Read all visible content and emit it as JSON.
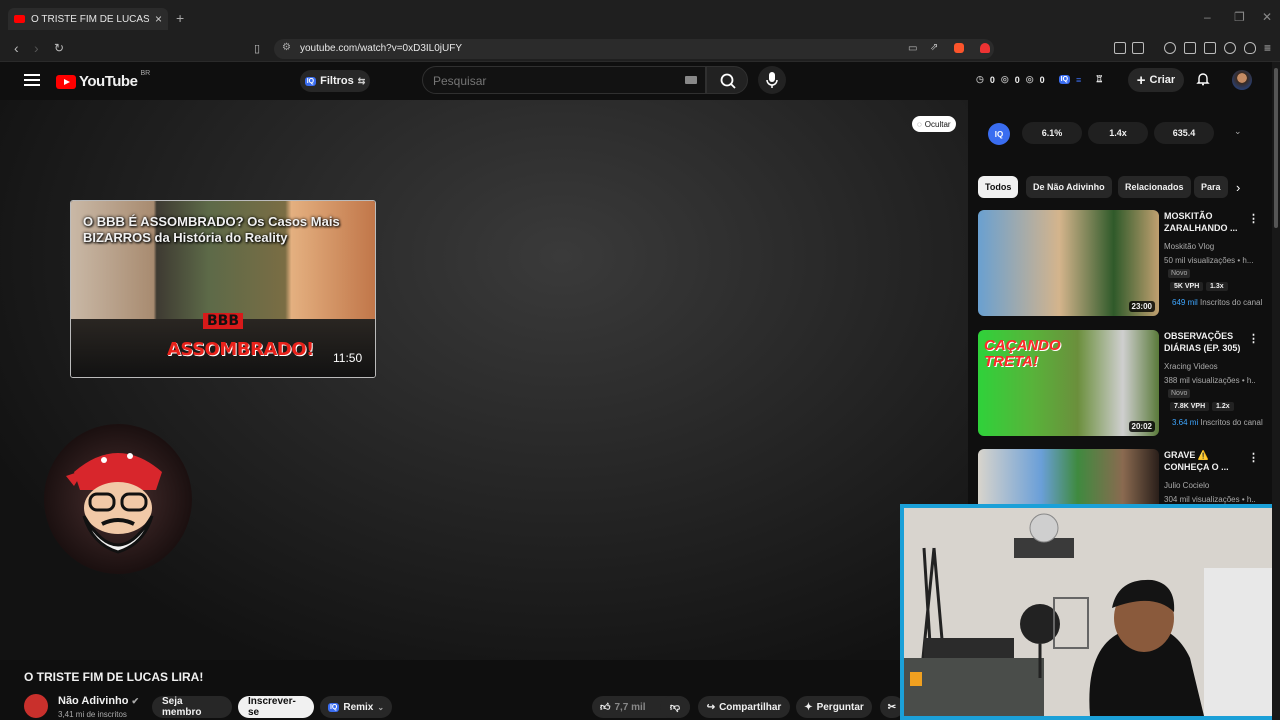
{
  "browser": {
    "tab_title": "O TRISTE FIM DE LUCAS LIRA! - YouTube",
    "url": "youtube.com/watch?v=0xD3IL0jUFY"
  },
  "header": {
    "logo": "YouTube",
    "country": "BR",
    "filters_label": "Filtros",
    "iq_label": "IQ",
    "search_placeholder": "Pesquisar",
    "counters": [
      "0",
      "0",
      "0"
    ],
    "create_label": "Criar"
  },
  "player": {
    "hide_label": "Ocultar",
    "endcard": {
      "title": "O BBB É ASSOMBRADO? Os Casos Mais BIZARROS da História do Reality",
      "bbb_text": "BBB",
      "assombrado_text": "ASSOMBRADO!",
      "duration": "11:50"
    }
  },
  "video": {
    "title": "O TRISTE FIM DE LUCAS LIRA!",
    "channel": "Não Adivinho",
    "subscribers": "3,41 mi de inscritos",
    "member_label": "Seja membro",
    "subscribe_label": "Inscrever-se",
    "remix_label": "Remix",
    "likes": "7,7 mil",
    "share_label": "Compartilhar",
    "ask_label": "Perguntar"
  },
  "sidebar": {
    "iq_metrics": [
      "6.1%",
      "1.4x",
      "635.4"
    ],
    "chips": [
      "Todos",
      "De Não Adivinho",
      "Relacionados",
      "Para"
    ],
    "recommendations": [
      {
        "title": "MOSKITÃO ZARALHANDO ...",
        "channel": "Moskitão Vlog",
        "views": "50 mil visualizações • h...",
        "badge": "Novo",
        "vph": "5K VPH",
        "ratio": "1.3x",
        "subs_count": "649 mil",
        "subs_label": "Inscritos do canal",
        "duration": "23:00",
        "colors": [
          "#6aa0d0",
          "#d4b48c",
          "#2f5a2a"
        ]
      },
      {
        "title": "OBSERVAÇÕES DIÁRIAS (EP. 305)",
        "channel": "Xracing Videos",
        "views": "388 mil visualizações • h...",
        "badge": "Novo",
        "vph": "7.8K VPH",
        "ratio": "1.2x",
        "subs_count": "3.64 mi",
        "subs_label": "Inscritos do canal",
        "duration": "20:02",
        "colors": [
          "#2fd23a",
          "#6b8f3c",
          "#cfcfcf"
        ]
      },
      {
        "title": "GRAVE ⚠️ CONHEÇA O ...",
        "channel": "Julio Cocielo",
        "views": "304 mil visualizações • h...",
        "duration": "",
        "colors": [
          "#d8d4cc",
          "#6a9fd8",
          "#8a6a50"
        ]
      }
    ]
  }
}
